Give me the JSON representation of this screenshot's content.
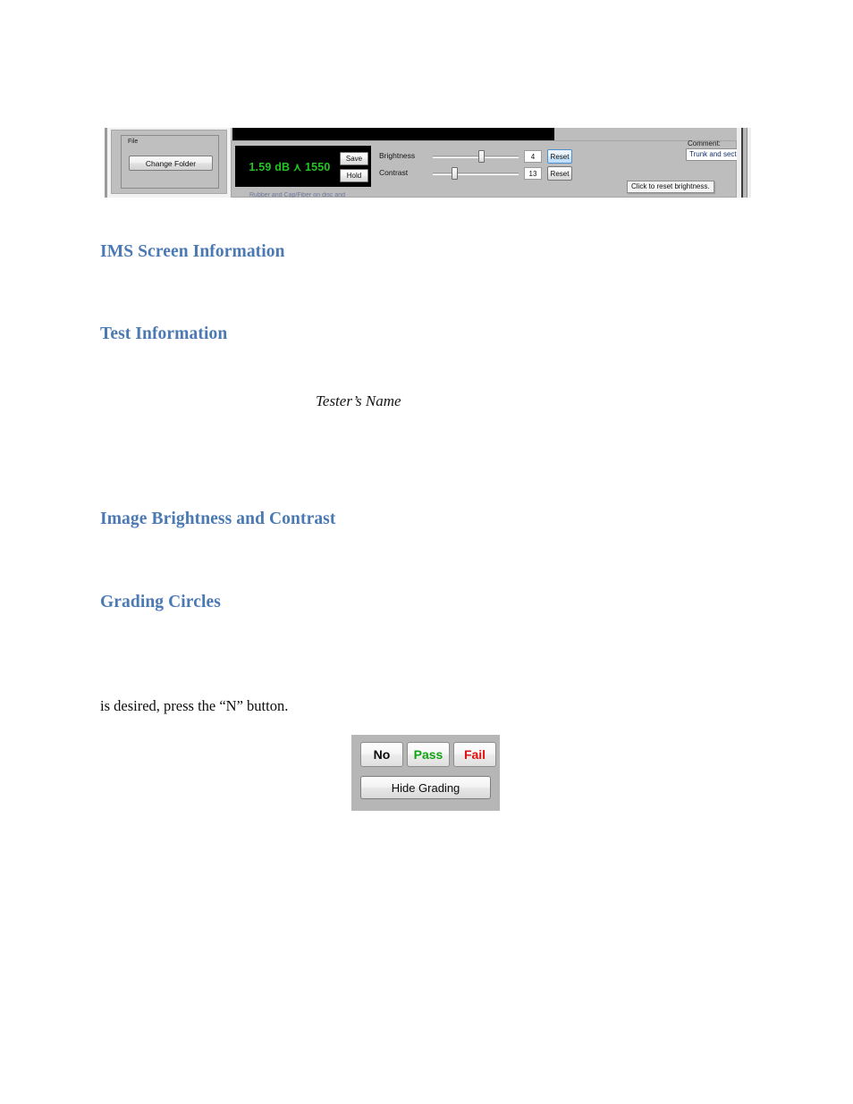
{
  "document": {
    "headings": {
      "ims_screen_information": "IMS Screen Information",
      "test_information": "Test Information",
      "image_brightness_and_contrast": "Image Brightness and Contrast",
      "grading_circles": "Grading Circles"
    },
    "testers_name_caption": "Tester’s Name",
    "body_paragraph": "is desired, press the “N” button."
  },
  "figure_toolbar": {
    "file_group": {
      "title": "File",
      "change_folder_label": "Change Folder"
    },
    "readout": {
      "value": "1.59 dB ⋏ 1550",
      "text_color": "#23c423",
      "background_color": "#000000",
      "save_label": "Save",
      "hold_label": "Hold"
    },
    "sliders": [
      {
        "label": "Brightness",
        "value": "4",
        "reset_label": "Reset",
        "thumb_percent": 57,
        "highlighted": true
      },
      {
        "label": "Contrast",
        "value": "13",
        "reset_label": "Reset",
        "thumb_percent": 24,
        "highlighted": false
      }
    ],
    "comment": {
      "label": "Comment:",
      "value": "Trunk and sector rooftop",
      "text_color": "#14306e"
    },
    "tooltip": {
      "text": "Click to reset brightness."
    },
    "clipped_row_text": "Rubber and Cap/Fiber on disc and"
  },
  "figure_grading": {
    "buttons": [
      {
        "label": "No",
        "color": "#0b0b0b"
      },
      {
        "label": "Pass",
        "color": "#12a312"
      },
      {
        "label": "Fail",
        "color": "#e31010"
      }
    ],
    "hide_grading_label": "Hide Grading"
  }
}
